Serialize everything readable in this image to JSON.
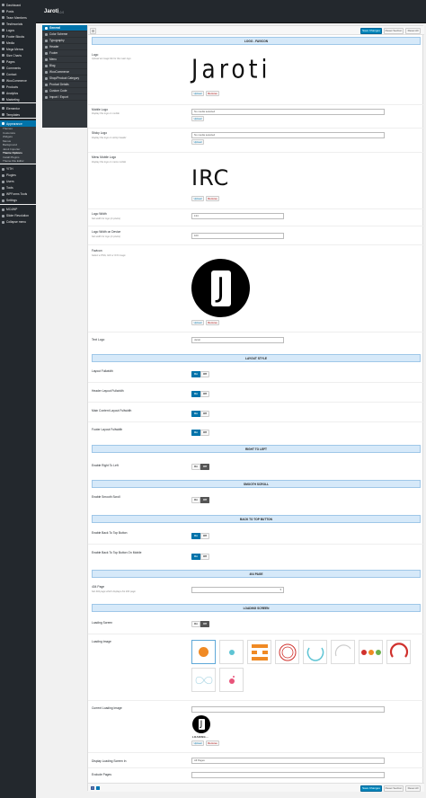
{
  "wp_menu": [
    {
      "label": "Dashboard",
      "kind": "item"
    },
    {
      "label": "Posts",
      "kind": "item"
    },
    {
      "label": "Team Members",
      "kind": "item"
    },
    {
      "label": "Testimonials",
      "kind": "item"
    },
    {
      "label": "Logos",
      "kind": "item"
    },
    {
      "label": "Footer Blocks",
      "kind": "item"
    },
    {
      "label": "Media",
      "kind": "item"
    },
    {
      "label": "Mega Menus",
      "kind": "item"
    },
    {
      "label": "Size Charts",
      "kind": "item"
    },
    {
      "label": "Pages",
      "kind": "item"
    },
    {
      "label": "Comments",
      "kind": "item"
    },
    {
      "label": "Contact",
      "kind": "item"
    },
    {
      "label": "WooCommerce",
      "kind": "item"
    },
    {
      "label": "Products",
      "kind": "item"
    },
    {
      "label": "Analytics",
      "kind": "item"
    },
    {
      "label": "Marketing",
      "kind": "item"
    },
    {
      "label": "",
      "kind": "sep"
    },
    {
      "label": "Elementor",
      "kind": "item"
    },
    {
      "label": "Templates",
      "kind": "item"
    },
    {
      "label": "",
      "kind": "sep"
    },
    {
      "label": "Appearance",
      "kind": "active"
    },
    {
      "label": "Themes",
      "kind": "sub"
    },
    {
      "label": "Customize",
      "kind": "sub"
    },
    {
      "label": "Widgets",
      "kind": "sub"
    },
    {
      "label": "Menus",
      "kind": "sub"
    },
    {
      "label": "Background",
      "kind": "sub"
    },
    {
      "label": "Jaroti Importer",
      "kind": "sub"
    },
    {
      "label": "Theme Options",
      "kind": "subcur"
    },
    {
      "label": "Install Plugins",
      "kind": "sub"
    },
    {
      "label": "Theme File Editor",
      "kind": "sub"
    },
    {
      "label": "",
      "kind": "sep"
    },
    {
      "label": "YITH",
      "kind": "item"
    },
    {
      "label": "Plugins",
      "kind": "item"
    },
    {
      "label": "Users",
      "kind": "item"
    },
    {
      "label": "Tools",
      "kind": "item"
    },
    {
      "label": "WPForms Tools",
      "kind": "item"
    },
    {
      "label": "Settings",
      "kind": "item"
    },
    {
      "label": "",
      "kind": "sep"
    },
    {
      "label": "MC4WP",
      "kind": "item"
    },
    {
      "label": "Slider Revolution",
      "kind": "item"
    },
    {
      "label": "Collapse menu",
      "kind": "item"
    }
  ],
  "header": {
    "title": "Jaroti",
    "version": "1.0.0"
  },
  "options_nav": [
    {
      "label": "General",
      "active": true
    },
    {
      "label": "Color Scheme",
      "active": false
    },
    {
      "label": "Typography",
      "active": false
    },
    {
      "label": "Header",
      "active": false
    },
    {
      "label": "Footer",
      "active": false
    },
    {
      "label": "Menu",
      "active": false
    },
    {
      "label": "Blog",
      "active": false
    },
    {
      "label": "WooCommerce",
      "active": false
    },
    {
      "label": "Shop/Product Category",
      "active": false
    },
    {
      "label": "Product Details",
      "active": false
    },
    {
      "label": "Custom Code",
      "active": false
    },
    {
      "label": "Import / Export",
      "active": false
    }
  ],
  "toolbar": {
    "save": "Save Changes",
    "reset_section": "Reset Section",
    "reset_all": "Reset All"
  },
  "sections": {
    "logo": "LOGO - FAVICON",
    "layout": "LAYOUT STYLE",
    "rtl": "RIGHT TO LEFT",
    "scroll": "SMOOTH SCROLL",
    "back": "BACK TO TOP BUTTON",
    "p404": "404 PAGE",
    "loading": "LOADING SCREEN"
  },
  "fields": {
    "logo": {
      "label": "Logo",
      "desc": "Upload an image file for the main logo",
      "image_text": "Jaroti"
    },
    "mobile_logo": {
      "label": "Mobile Logo",
      "desc": "Display this logo on mobile",
      "value": "No media selected"
    },
    "sticky_logo": {
      "label": "Sticky Logo",
      "desc": "Display this logo on sticky header",
      "value": "No media selected"
    },
    "menu_mobile_logo": {
      "label": "Menu Mobile Logo",
      "desc": "Display this logo on menu mobile",
      "image_text": "IRC"
    },
    "logo_width": {
      "label": "Logo Width",
      "desc": "Set width for logo (in pixels)",
      "value": "134"
    },
    "logo_width_device": {
      "label": "Logo Width on Device",
      "desc": "Set width for logo (in pixels)",
      "value": "100"
    },
    "favicon": {
      "label": "Favicon",
      "desc": "Select a PNG, GIF or ICO image",
      "image_text": "J"
    },
    "text_logo": {
      "label": "Text Logo",
      "value": "Jaroti"
    },
    "layout_fullwidth": {
      "label": "Layout Fullwidth",
      "state": "on"
    },
    "header_fullwidth": {
      "label": "Header Layout Fullwidth",
      "state": "on"
    },
    "main_fullwidth": {
      "label": "Main Content Layout Fullwidth",
      "state": "on"
    },
    "footer_fullwidth": {
      "label": "Footer Layout Fullwidth",
      "state": "on"
    },
    "rtl": {
      "label": "Enable Right To Left",
      "state": "off"
    },
    "smooth": {
      "label": "Enable Smooth Scroll",
      "state": "off"
    },
    "back_top": {
      "label": "Enable Back To Top Button",
      "state": "on"
    },
    "back_top_mobile": {
      "label": "Enable Back To Top Button On Mobile",
      "state": "on"
    },
    "page404": {
      "label": "404 Page",
      "desc": "Set 404 page which displays the 404 page",
      "value": ""
    },
    "loading_screen": {
      "label": "Loading Screen",
      "state": "off"
    },
    "loading_image": {
      "label": "Loading Image"
    },
    "current_loading": {
      "label": "Current Loading Image",
      "caption": "LOADING...",
      "image_text": "J"
    },
    "display_loading": {
      "label": "Display Loading Screen In",
      "value": "All Pages"
    },
    "exclude": {
      "label": "Exclude Pages",
      "value": ""
    }
  },
  "toggle": {
    "on": "On",
    "off": "Off"
  },
  "upload_btn": "Upload",
  "remove_btn": "Remove",
  "colors": {
    "accent": "#0073aa",
    "section_bg": "#d6e9f9",
    "dark": "#23282d",
    "loader_orange": "#f08a24",
    "loader_red": "#d0312d"
  }
}
